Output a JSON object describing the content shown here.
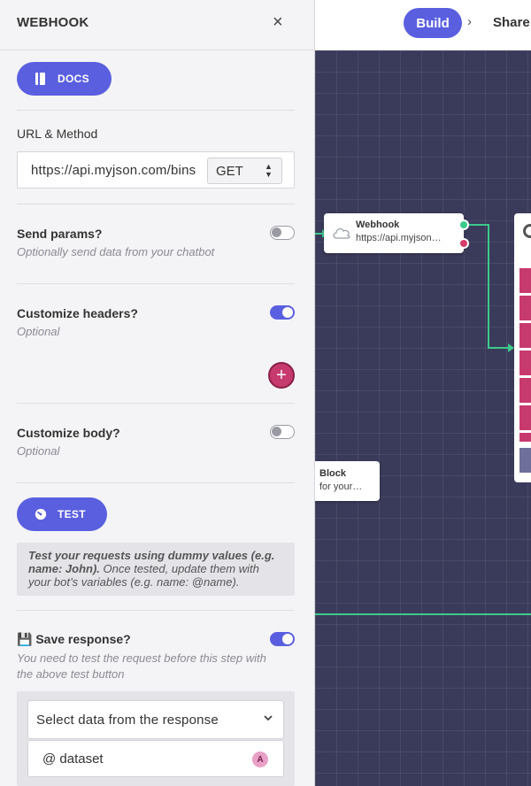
{
  "topbar": {
    "build_label": "Build",
    "separator": "›",
    "share_label": "Share"
  },
  "canvas": {
    "webhook_node": {
      "title": "Webhook",
      "subtitle": "https://api.myjson…"
    },
    "block_node": {
      "title": "Block",
      "subtitle": "for your…"
    }
  },
  "panel": {
    "title": "WEBHOOK",
    "close_symbol": "×",
    "docs_label": "DOCS",
    "url_method": {
      "label": "URL & Method",
      "url_value": "https://api.myjson.com/bins",
      "method_value": "GET"
    },
    "send_params": {
      "label": "Send params?",
      "hint": "Optionally send data from your chatbot",
      "enabled": false
    },
    "custom_headers": {
      "label": "Customize headers?",
      "hint": "Optional",
      "enabled": true,
      "add_symbol": "+"
    },
    "custom_body": {
      "label": "Customize body?",
      "hint": "Optional",
      "enabled": false
    },
    "test": {
      "label": "TEST",
      "info_bold": "Test your requests using dummy values (e.g. name: John).",
      "info_rest": " Once tested, update them with your bot’s variables (e.g. name: @name)."
    },
    "save_response": {
      "emoji": "💾",
      "label": "Save response?",
      "hint": "You need to test the request before this step with the above test button",
      "enabled": true,
      "select_placeholder": "Select data from the response",
      "variable_value": "@ dataset",
      "variable_badge": "A"
    }
  },
  "colors": {
    "accent": "#5a5fe0",
    "danger": "#c73a6e",
    "success": "#3cc98b",
    "canvas_bg": "#3a3b5a"
  }
}
